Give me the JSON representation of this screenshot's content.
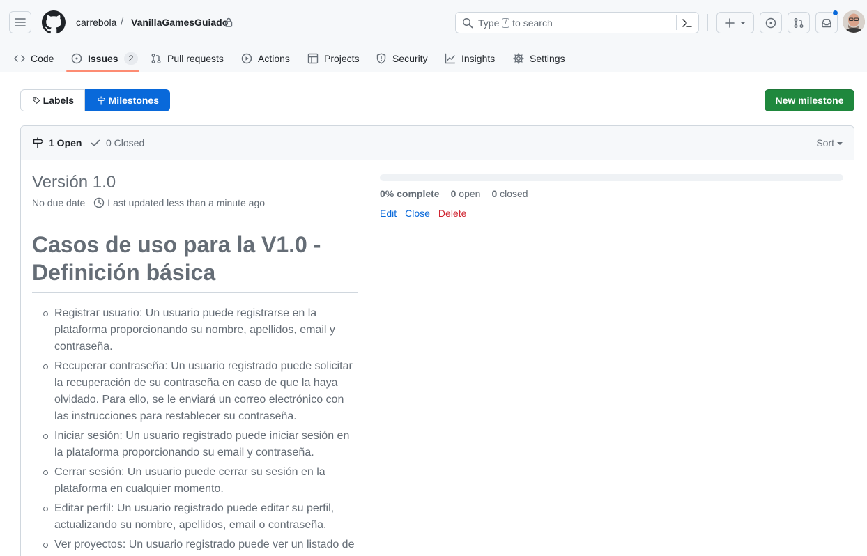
{
  "header": {
    "owner": "carrebola",
    "separator": "/",
    "repo": "VanillaGamesGuiado",
    "search": {
      "prefix": "Type",
      "key": "/",
      "suffix": "to search"
    }
  },
  "nav": {
    "tabs": [
      {
        "label": "Code",
        "icon": "code-icon"
      },
      {
        "label": "Issues",
        "icon": "issue-opened-icon",
        "count": "2",
        "active": true
      },
      {
        "label": "Pull requests",
        "icon": "git-pull-request-icon"
      },
      {
        "label": "Actions",
        "icon": "play-icon"
      },
      {
        "label": "Projects",
        "icon": "table-icon"
      },
      {
        "label": "Security",
        "icon": "shield-icon"
      },
      {
        "label": "Insights",
        "icon": "graph-icon"
      },
      {
        "label": "Settings",
        "icon": "gear-icon"
      }
    ]
  },
  "toolbar": {
    "labels": "Labels",
    "milestones": "Milestones",
    "new_milestone": "New milestone"
  },
  "list": {
    "open": "1 Open",
    "closed": "0 Closed",
    "sort": "Sort"
  },
  "milestone": {
    "title": "Versión 1.0",
    "due": "No due date",
    "updated": "Last updated less than a minute ago",
    "progress_percent": 0,
    "complete": "0% complete",
    "open_count": "0",
    "open_label": "open",
    "closed_count": "0",
    "closed_label": "closed",
    "edit": "Edit",
    "close": "Close",
    "delete": "Delete",
    "description": {
      "heading": "Casos de uso para la V1.0 - Definición básica",
      "items": [
        "Registrar usuario: Un usuario puede registrarse en la plataforma proporcionando su nombre, apellidos, email y contraseña.",
        "Recuperar contraseña: Un usuario registrado puede solicitar la recuperación de su contraseña en caso de que la haya olvidado. Para ello, se le enviará un correo electrónico con las instrucciones para restablecer su contraseña.",
        "Iniciar sesión: Un usuario registrado puede iniciar sesión en la plataforma proporcionando su email y contraseña.",
        "Cerrar sesión: Un usuario puede cerrar su sesión en la plataforma en cualquier momento.",
        "Editar perfil: Un usuario registrado puede editar su perfil, actualizando su nombre, apellidos, email o contraseña.",
        "Ver proyectos: Un usuario registrado puede ver un listado de proyectos disponibles en la plataforma."
      ]
    }
  },
  "colors": {
    "accent": "#0969da",
    "success": "#1f883d",
    "danger": "#cf222e",
    "tab_underline": "#fd8c73"
  }
}
